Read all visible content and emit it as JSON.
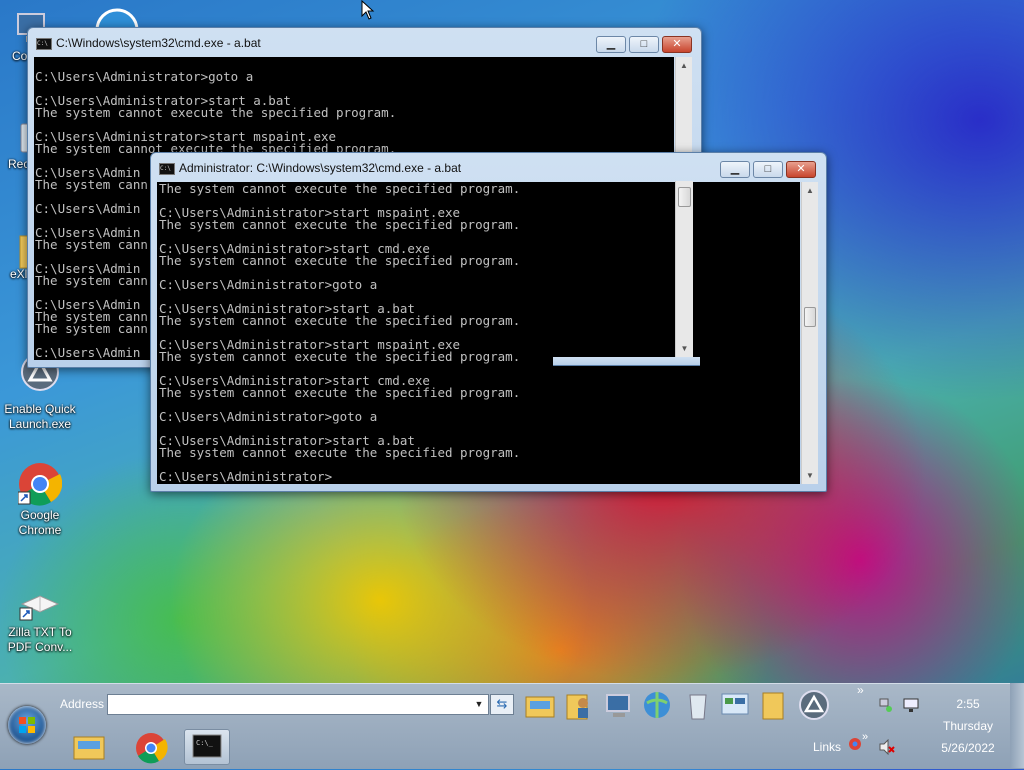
{
  "desktop": {
    "icons": [
      {
        "label": "Co"
      },
      {
        "label": "Rec"
      },
      {
        "label": "eXl"
      },
      {
        "label": "Enable Quick Launch.exe"
      },
      {
        "label": "Google Chrome"
      },
      {
        "label": "Zilla TXT To PDF Conv..."
      }
    ]
  },
  "window_back": {
    "title": "C:\\Windows\\system32\\cmd.exe - a.bat",
    "lines": [
      "C:\\Users\\Administrator>goto a",
      "",
      "C:\\Users\\Administrator>start a.bat",
      "The system cannot execute the specified program.",
      "",
      "C:\\Users\\Administrator>start mspaint.exe",
      "The system cannot execute the specified program.",
      "",
      "C:\\Users\\Admin",
      "The system cann",
      "",
      "C:\\Users\\Admin",
      "",
      "C:\\Users\\Admin",
      "The system cann",
      "",
      "C:\\Users\\Admin",
      "The system cann",
      "",
      "C:\\Users\\Admin",
      "The system cann",
      "The system cann",
      "",
      "C:\\Users\\Admin"
    ]
  },
  "window_front": {
    "title": "Administrator: C:\\Windows\\system32\\cmd.exe - a.bat",
    "lines": [
      "The system cannot execute the specified program.",
      "",
      "C:\\Users\\Administrator>start mspaint.exe",
      "The system cannot execute the specified program.",
      "",
      "C:\\Users\\Administrator>start cmd.exe",
      "The system cannot execute the specified program.",
      "",
      "C:\\Users\\Administrator>goto a",
      "",
      "C:\\Users\\Administrator>start a.bat",
      "The system cannot execute the specified program.",
      "",
      "C:\\Users\\Administrator>start mspaint.exe",
      "The system cannot execute the specified program.",
      "",
      "C:\\Users\\Administrator>start cmd.exe",
      "The system cannot execute the specified program.",
      "",
      "C:\\Users\\Administrator>goto a",
      "",
      "C:\\Users\\Administrator>start a.bat",
      "The system cannot execute the specified program.",
      "",
      "C:\\Users\\Administrator>"
    ]
  },
  "taskbar": {
    "address_label": "Address",
    "address_value": "",
    "links_label": "Links",
    "overflow_chevron": "»",
    "clock_time": "2:55",
    "clock_day": "Thursday",
    "clock_date": "5/26/2022"
  },
  "icons": {
    "control_minimize": "minimize-icon",
    "control_maximize": "maximize-icon",
    "control_close": "close-icon"
  }
}
